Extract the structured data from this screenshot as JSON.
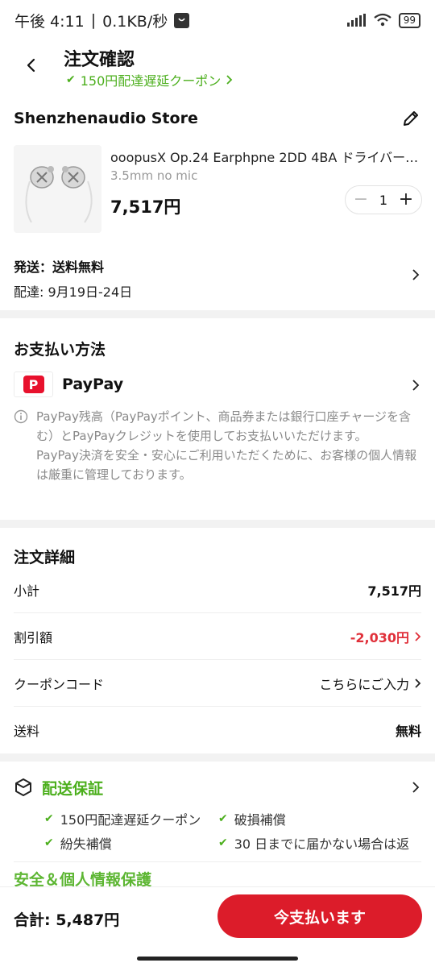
{
  "status_bar": {
    "time": "午後 4:11",
    "net_speed": "0.1KB/秒",
    "battery": "99"
  },
  "header": {
    "title": "注文確認",
    "coupon_link": "150円配達遅延クーポン"
  },
  "store": {
    "name": "Shenzhenaudio Store",
    "product": {
      "title": "ooopusX Op.24 Earphpne 2DD 4BA ドライバー OP...",
      "variant": "3.5mm no mic",
      "price": "7,517円",
      "quantity": "1"
    },
    "shipping": "発送：送料無料",
    "delivery": "配達: 9月19日-24日"
  },
  "payment": {
    "title": "お支払い方法",
    "method": "PayPay",
    "note_1": "PayPay残高（PayPayポイント、商品券または銀行口座チャージを含む）とPayPayクレジットを使用してお支払いいただけます。",
    "note_2": "PayPay決済を安全・安心にご利用いただくために、お客様の個人情報は厳重に管理しております。"
  },
  "order_details": {
    "title": "注文詳細",
    "rows": [
      {
        "label": "小計",
        "value": "7,517円"
      },
      {
        "label": "割引額",
        "value": "-2,030円"
      },
      {
        "label": "クーポンコード",
        "value": "こちらにご入力"
      },
      {
        "label": "送料",
        "value": "無料"
      }
    ]
  },
  "guarantee": {
    "title": "配送保証",
    "items": [
      "150円配達遅延クーポン",
      "破損補償",
      "紛失補償",
      "30 日までに届かない場合は返"
    ],
    "next_title": "安全＆個人情報保護"
  },
  "footer": {
    "total_label": "合計: 5,487円",
    "pay_button": "今支払います"
  },
  "colors": {
    "accent_green": "#4caf1d",
    "primary_red": "#dc1c2a",
    "discount_red": "#e0303a"
  }
}
